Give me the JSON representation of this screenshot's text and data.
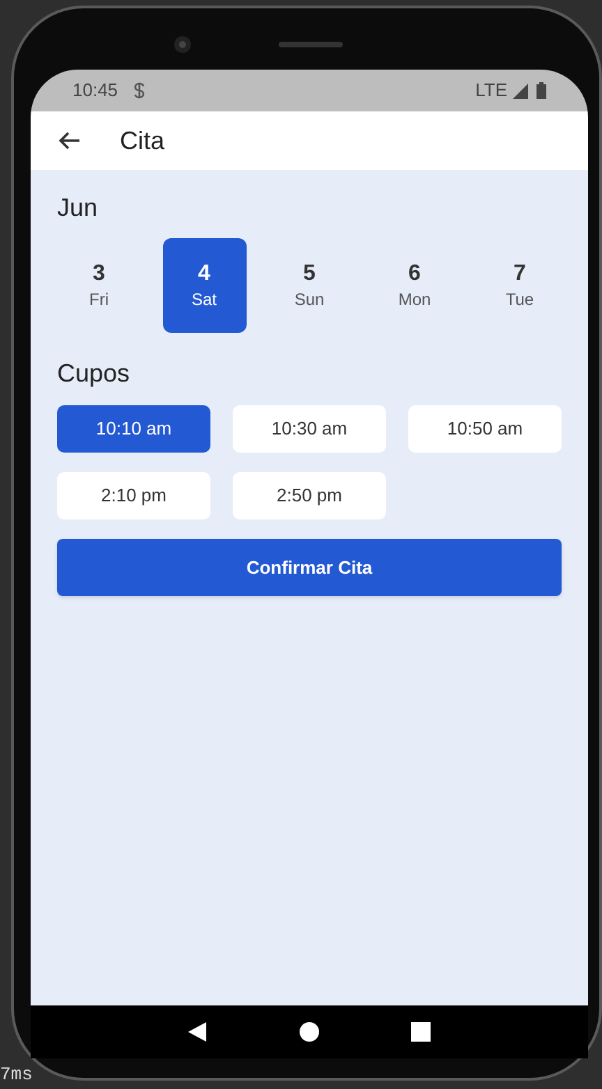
{
  "status_bar": {
    "time": "10:45",
    "network": "LTE"
  },
  "app_bar": {
    "title": "Cita"
  },
  "month": "Jun",
  "days": [
    {
      "number": "3",
      "weekday": "Fri",
      "selected": false
    },
    {
      "number": "4",
      "weekday": "Sat",
      "selected": true
    },
    {
      "number": "5",
      "weekday": "Sun",
      "selected": false
    },
    {
      "number": "6",
      "weekday": "Mon",
      "selected": false
    },
    {
      "number": "7",
      "weekday": "Tue",
      "selected": false
    }
  ],
  "slots_title": "Cupos",
  "slots": [
    {
      "label": "10:10 am",
      "selected": true
    },
    {
      "label": "10:30 am",
      "selected": false
    },
    {
      "label": "10:50 am",
      "selected": false
    },
    {
      "label": "2:10 pm",
      "selected": false
    },
    {
      "label": "2:50 pm",
      "selected": false
    }
  ],
  "confirm_button": "Confirmar Cita",
  "overlay_text": "7ms"
}
